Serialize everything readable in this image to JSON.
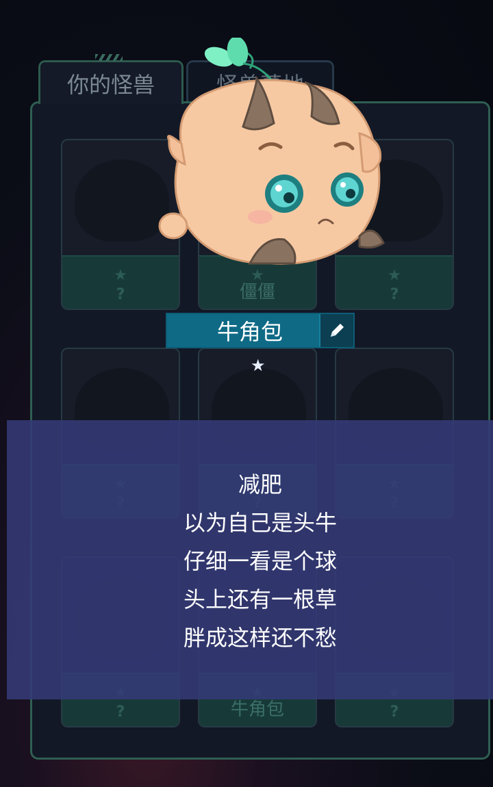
{
  "tabs": {
    "yours": "你的怪兽",
    "graveyard": "怪兽墓地"
  },
  "cards": [
    {
      "star": "★",
      "name": "?"
    },
    {
      "star": "★",
      "name": "僵僵"
    },
    {
      "star": "★",
      "name": "?"
    },
    {
      "star": "★",
      "name": "?"
    },
    {
      "star": "★",
      "name": "?"
    },
    {
      "star": "★",
      "name": "?"
    },
    {
      "star": "★",
      "name": "?"
    },
    {
      "star": "★",
      "name": "牛角包"
    },
    {
      "star": "★",
      "name": "?"
    }
  ],
  "selected": {
    "name": "牛角包",
    "rarity_star": "★",
    "edit_icon": "pencil-icon",
    "description": [
      "减肥",
      "以为自己是头牛",
      "仔细一看是个球",
      "头上还有一根草",
      "胖成这样还不愁"
    ]
  },
  "colors": {
    "accent": "#0f6a86",
    "panel_border": "#2f5f52",
    "overlay": "#343a76"
  }
}
